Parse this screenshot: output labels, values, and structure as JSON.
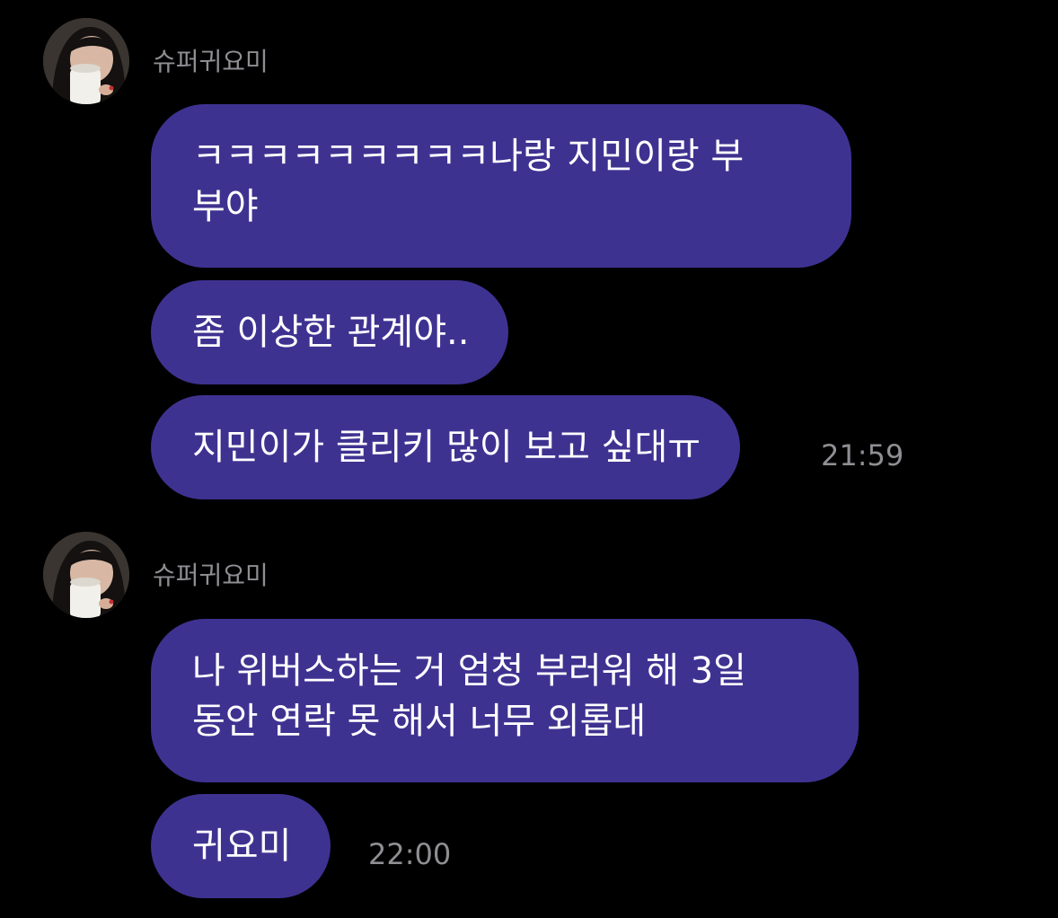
{
  "groups": [
    {
      "sender": "슈퍼귀요미",
      "messages": [
        {
          "line1": "ㅋㅋㅋㅋㅋㅋㅋㅋㅋ나랑 지민이랑 부",
          "line2": "부야"
        },
        {
          "text": "좀 이상한 관계야.."
        },
        {
          "text": "지민이가 클리키 많이 보고 싶대ㅠ"
        }
      ],
      "time": "21:59"
    },
    {
      "sender": "슈퍼귀요미",
      "messages": [
        {
          "line1": "나 위버스하는 거 엄청 부러워 해 3일",
          "line2": "동안 연락 못 해서 너무 외롭대"
        },
        {
          "text": "귀요미"
        }
      ],
      "time": "22:00"
    }
  ],
  "colors": {
    "background": "#000000",
    "bubble": "#3e3291",
    "message_text": "#ffffff",
    "meta_text": "#8e8e93"
  },
  "icons": {
    "avatar": "profile-photo"
  }
}
